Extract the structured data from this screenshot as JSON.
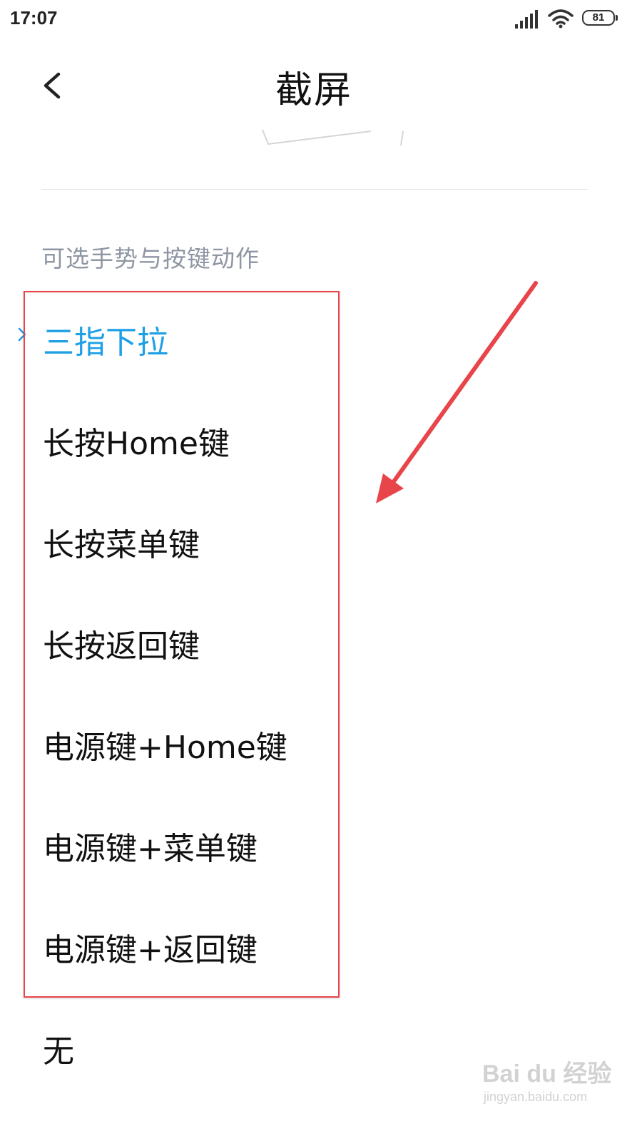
{
  "status_bar": {
    "time": "17:07",
    "battery": "81"
  },
  "header": {
    "title": "截屏",
    "back_icon": "chevron-left-icon"
  },
  "section": {
    "header": "可选手势与按键动作"
  },
  "options": [
    {
      "label": "三指下拉",
      "selected": true
    },
    {
      "label": "长按Home键",
      "selected": false
    },
    {
      "label": "长按菜单键",
      "selected": false
    },
    {
      "label": "长按返回键",
      "selected": false
    },
    {
      "label": "电源键+Home键",
      "selected": false
    },
    {
      "label": "电源键+菜单键",
      "selected": false
    },
    {
      "label": "电源键+返回键",
      "selected": false
    },
    {
      "label": "无",
      "selected": false
    }
  ],
  "colors": {
    "accent": "#1e9fe6",
    "section_header": "#8f96a3",
    "annotation": "#e8454a"
  },
  "watermark": {
    "logo": "Bai du 经验",
    "url": "jingyan.baidu.com"
  }
}
